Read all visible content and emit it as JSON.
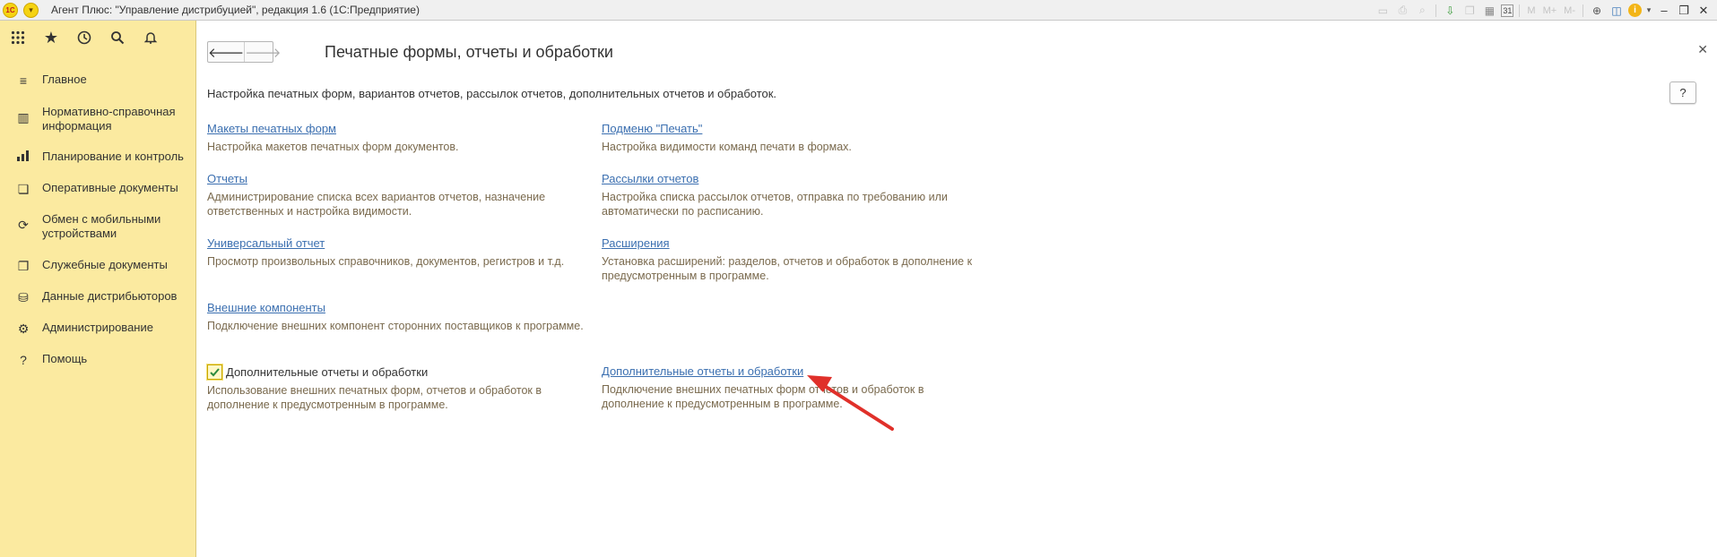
{
  "titlebar": {
    "logo": "1С",
    "title": "Агент Плюс: \"Управление дистрибуцией\", редакция 1.6  (1С:Предприятие)",
    "tools": [
      "save-icon",
      "print-icon",
      "preview-icon",
      "export-icon",
      "copy-icon",
      "table-icon",
      "calendar-icon"
    ],
    "calendar_day": "31",
    "m_labels": [
      "M",
      "M+",
      "M-"
    ]
  },
  "sidebar": {
    "items": [
      {
        "label": "Главное",
        "icon": "menu-lines-icon"
      },
      {
        "label": "Нормативно-справочная информация",
        "icon": "catalog-icon"
      },
      {
        "label": "Планирование и контроль",
        "icon": "chart-icon"
      },
      {
        "label": "Оперативные документы",
        "icon": "documents-icon"
      },
      {
        "label": "Обмен с мобильными устройствами",
        "icon": "sync-icon"
      },
      {
        "label": "Служебные документы",
        "icon": "service-docs-icon"
      },
      {
        "label": "Данные дистрибьюторов",
        "icon": "distributor-data-icon"
      },
      {
        "label": "Администрирование",
        "icon": "gear-icon"
      },
      {
        "label": "Помощь",
        "icon": "help-icon"
      }
    ]
  },
  "main": {
    "title": "Печатные формы, отчеты и обработки",
    "description": "Настройка печатных форм, вариантов отчетов, рассылок отчетов, дополнительных отчетов и обработок.",
    "help_label": "?",
    "left": [
      {
        "link": "Макеты печатных форм",
        "note": "Настройка макетов печатных форм документов."
      },
      {
        "link": "Отчеты",
        "note": "Администрирование списка всех вариантов отчетов, назначение ответственных и настройка видимости."
      },
      {
        "link": "Универсальный отчет",
        "note": "Просмотр произвольных справочников, документов, регистров и т.д."
      },
      {
        "link": "Внешние компоненты",
        "note": "Подключение внешних компонент сторонних поставщиков к программе."
      }
    ],
    "checkbox": {
      "label": "Дополнительные отчеты и обработки",
      "checked": true,
      "note": "Использование внешних печатных форм, отчетов и обработок в дополнение к предусмотренным в программе."
    },
    "right": [
      {
        "link": "Подменю \"Печать\"",
        "note": "Настройка видимости команд печати в формах."
      },
      {
        "link": "Рассылки отчетов",
        "note": "Настройка списка рассылок отчетов, отправка по требованию или автоматически по расписанию."
      },
      {
        "link": "Расширения",
        "note": "Установка расширений: разделов, отчетов и обработок в дополнение к предусмотренным в программе."
      },
      {
        "link": "Дополнительные отчеты и обработки",
        "note": "Подключение внешних печатных форм отчетов и обработок в дополнение к предусмотренным в программе."
      }
    ]
  },
  "annotation": {
    "arrow_color": "#e0302a"
  }
}
